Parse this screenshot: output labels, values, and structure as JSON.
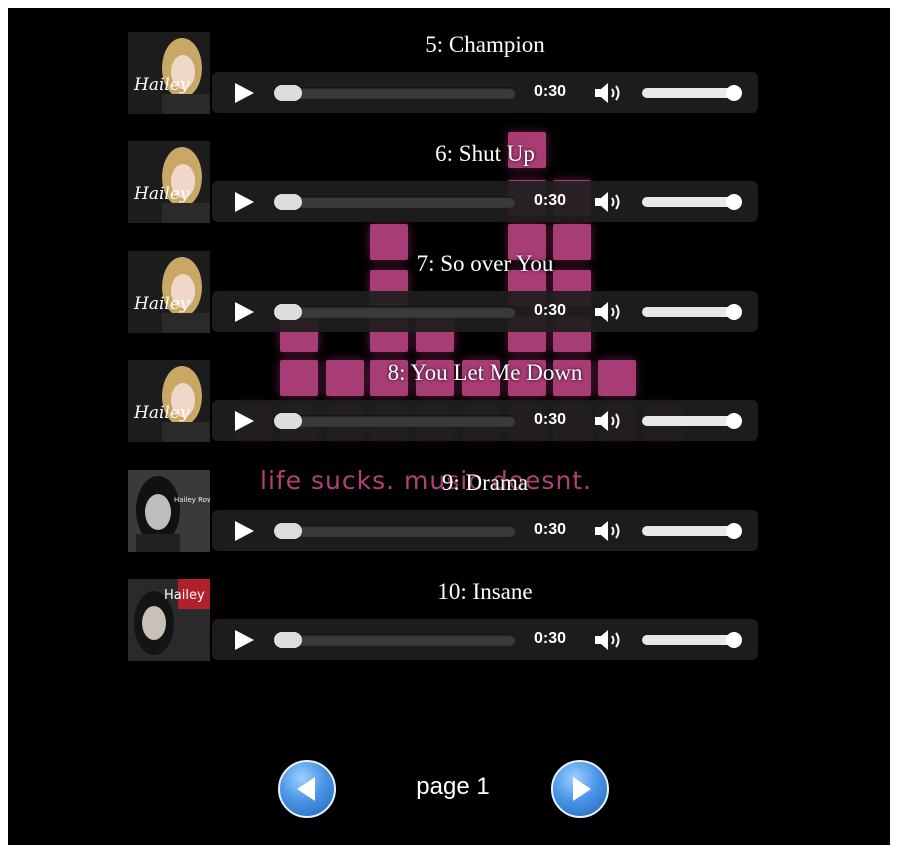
{
  "tracks": [
    {
      "title": "5: Champion",
      "time": "0:30",
      "cover": "hailey-portrait"
    },
    {
      "title": "6: Shut Up",
      "time": "0:30",
      "cover": "hailey-portrait"
    },
    {
      "title": "7: So over You",
      "time": "0:30",
      "cover": "hailey-portrait"
    },
    {
      "title": "8: You Let Me Down",
      "time": "0:30",
      "cover": "hailey-portrait"
    },
    {
      "title": "9: Drama",
      "time": "0:30",
      "cover": "hailey-bw-portrait"
    },
    {
      "title": "10: Insane",
      "time": "0:30",
      "cover": "hailey-red-cover"
    }
  ],
  "player": {
    "progress": 0,
    "volume": 1,
    "play_icon": "play-icon",
    "volume_icon": "speaker-icon"
  },
  "cover_texts": {
    "script_signature": "Hailey",
    "bw_cover_text": "Hailey Rowe",
    "red_cover_text": "Hailey"
  },
  "background": {
    "slogan": "life sucks. music doesnt."
  },
  "pagination": {
    "label": "page 1",
    "prev_icon": "left-arrow-icon",
    "next_icon": "right-arrow-icon"
  },
  "colors": {
    "background": "#000000",
    "accent_pink": "#e0509b",
    "nav_blue": "#4b96e6"
  }
}
